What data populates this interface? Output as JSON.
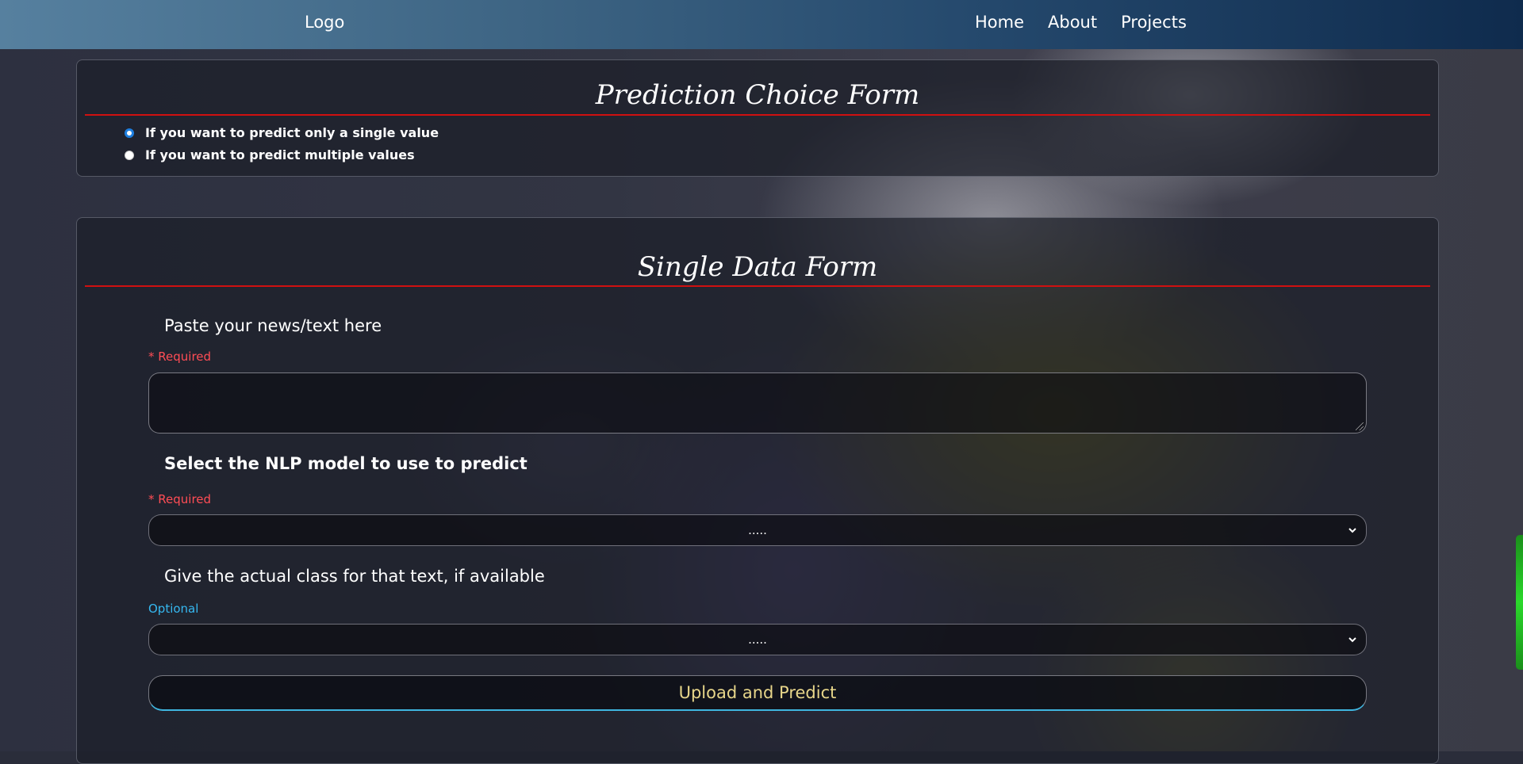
{
  "navbar": {
    "logo": "Logo",
    "links": [
      "Home",
      "About",
      "Projects"
    ]
  },
  "choice_form": {
    "title": "Prediction Choice Form",
    "options": [
      {
        "label": "If you want to predict only a single value",
        "checked": true
      },
      {
        "label": "If you want to predict multiple values",
        "checked": false
      }
    ]
  },
  "single_form": {
    "title": "Single Data Form",
    "text_field": {
      "label": "Paste your news/text here",
      "tag": "* Required",
      "value": ""
    },
    "model_select": {
      "label": "Select the NLP model to use to predict",
      "tag": "* Required",
      "value": "....."
    },
    "class_select": {
      "label": "Give the actual class for that text, if available",
      "tag": "Optional",
      "value": "....."
    },
    "submit_label": "Upload and Predict"
  },
  "colors": {
    "required": "#ff4d55",
    "optional": "#35b8f0",
    "title_rule": "#d01010",
    "button_text": "#e8d68a"
  }
}
